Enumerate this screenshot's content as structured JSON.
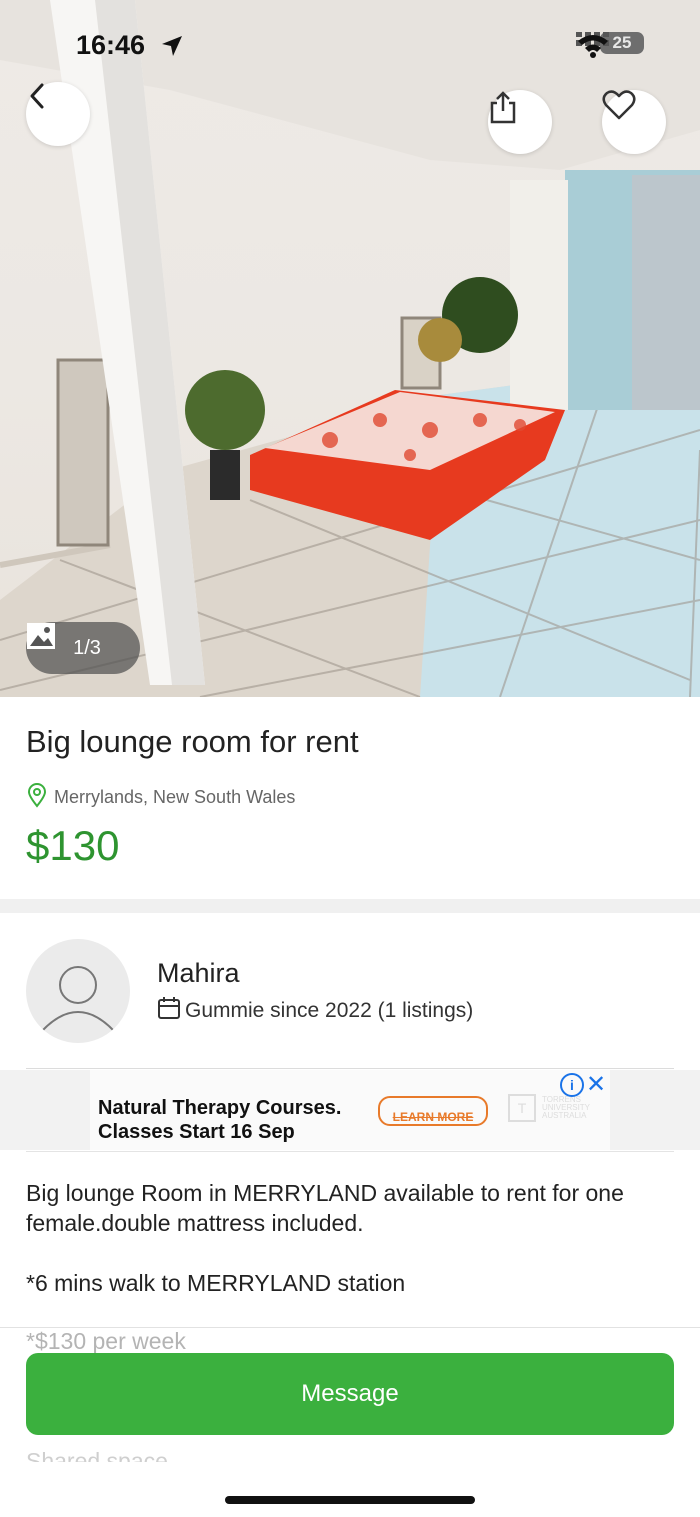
{
  "status_bar": {
    "time": "16:46",
    "battery": "25"
  },
  "gallery": {
    "counter": "1/3"
  },
  "listing": {
    "title": "Big lounge room for rent",
    "location": "Merrylands, New South Wales",
    "price": "$130"
  },
  "seller": {
    "name": "Mahira",
    "since": "Gummie since 2022 (1 listings)"
  },
  "ad": {
    "line1": "Natural Therapy Courses.",
    "line2": "Classes Start 16 Sep",
    "cta": "LEARN MORE",
    "logo_line1": "TORRENS",
    "logo_line2": "UNIVERSITY",
    "logo_line3": "AUSTRALIA"
  },
  "description": {
    "line1": "Big lounge Room in MERRYLAND available to rent for one",
    "line2": "female.double mattress included.",
    "line3": "*6 mins walk to MERRYLAND station",
    "line4": "*$130 per week",
    "line5": "Shared space"
  },
  "actions": {
    "message": "Message"
  },
  "colors": {
    "price": "#2e9430",
    "button": "#3bb03e",
    "ad_cta": "#e87a2a"
  }
}
